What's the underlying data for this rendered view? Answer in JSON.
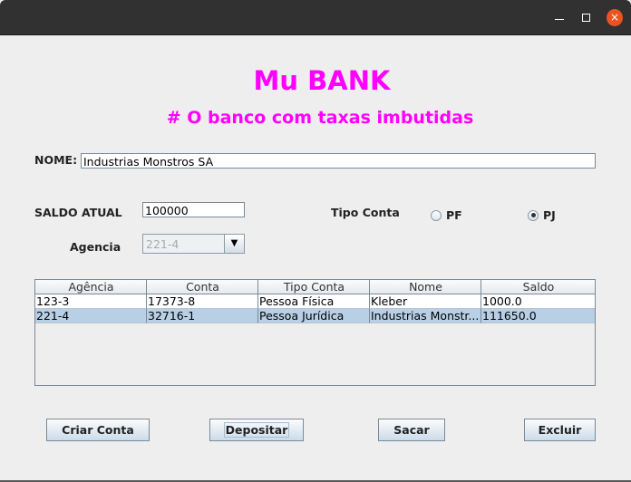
{
  "window": {
    "controls": {
      "minimize": "minimize-icon",
      "maximize": "maximize-icon",
      "close": "×"
    },
    "close_color": "#e95420"
  },
  "header": {
    "title": "Mu BANK",
    "subtitle": "# O banco com taxas imbutidas",
    "color": "#ff00ff"
  },
  "form": {
    "nome_label": "NOME:",
    "nome_value": "Industrias Monstros SA",
    "saldo_label": "SALDO ATUAL",
    "saldo_value": "100000",
    "agencia_label": "Agencia",
    "agencia_value": "221-4",
    "tipo_label": "Tipo Conta",
    "radios": [
      {
        "label": "PF",
        "selected": false
      },
      {
        "label": "PJ",
        "selected": true
      }
    ]
  },
  "table": {
    "columns": [
      "Agência",
      "Conta",
      "Tipo Conta",
      "Nome",
      "Saldo"
    ],
    "rows": [
      [
        "123-3",
        "17373-8",
        "Pessoa Física",
        "Kleber",
        "1000.0"
      ],
      [
        "221-4",
        "32716-1",
        "Pessoa Jurídica",
        "Industrias Monstr...",
        "111650.0"
      ]
    ],
    "selected_row": 1
  },
  "buttons": {
    "criar": "Criar Conta",
    "depositar": "Depositar",
    "sacar": "Sacar",
    "excluir": "Excluir"
  }
}
